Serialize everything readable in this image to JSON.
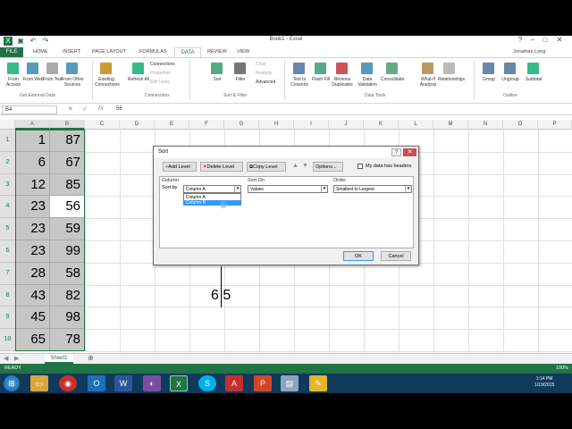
{
  "window": {
    "title": "Book1 - Excel",
    "user": "Jonathan Long"
  },
  "tabs": [
    "FILE",
    "HOME",
    "INSERT",
    "PAGE LAYOUT",
    "FORMULAS",
    "DATA",
    "REVIEW",
    "VIEW"
  ],
  "ribbon": {
    "buttons": [
      {
        "label": "From Access"
      },
      {
        "label": "From Web"
      },
      {
        "label": "From Text"
      },
      {
        "label": "From Other Sources"
      },
      {
        "label": "Existing Connections"
      },
      {
        "label": "Refresh All"
      },
      {
        "label": "Connections"
      },
      {
        "label": "Properties"
      },
      {
        "label": "Edit Links"
      },
      {
        "label": "Sort"
      },
      {
        "label": "Filter"
      },
      {
        "label": "Clear"
      },
      {
        "label": "Reapply"
      },
      {
        "label": "Advanced"
      },
      {
        "label": "Text to Columns"
      },
      {
        "label": "Flash Fill"
      },
      {
        "label": "Remove Duplicates"
      },
      {
        "label": "Data Validation"
      },
      {
        "label": "Consolidate"
      },
      {
        "label": "What-If Analysis"
      },
      {
        "label": "Relationships"
      },
      {
        "label": "Group"
      },
      {
        "label": "Ungroup"
      },
      {
        "label": "Subtotal"
      }
    ],
    "groups": [
      "Get External Data",
      "Connections",
      "Sort & Filter",
      "Data Tools",
      "Outline"
    ]
  },
  "formula_bar": {
    "name_box": "B4",
    "value": "56"
  },
  "columns": [
    "A",
    "B",
    "C",
    "D",
    "E",
    "F",
    "G",
    "H",
    "I",
    "J",
    "K",
    "L",
    "M",
    "N",
    "O",
    "P"
  ],
  "rows": [
    {
      "n": "1",
      "a": "1",
      "b": "87"
    },
    {
      "n": "2",
      "a": "6",
      "b": "67"
    },
    {
      "n": "3",
      "a": "12",
      "b": "85"
    },
    {
      "n": "4",
      "a": "23",
      "b": "56"
    },
    {
      "n": "5",
      "a": "23",
      "b": "59"
    },
    {
      "n": "6",
      "a": "23",
      "b": "99"
    },
    {
      "n": "7",
      "a": "28",
      "b": "58"
    },
    {
      "n": "8",
      "a": "43",
      "b": "82"
    },
    {
      "n": "9",
      "a": "45",
      "b": "98"
    },
    {
      "n": "10",
      "a": "65",
      "b": "78"
    }
  ],
  "dialog": {
    "title": "Sort",
    "help": "?",
    "close": "✕",
    "add_level": "Add Level",
    "delete_level": "Delete Level",
    "copy_level": "Copy Level",
    "options": "Options...",
    "headers_label": "My data has headers",
    "col_header": "Column",
    "sorton_header": "Sort On",
    "order_header": "Order",
    "sort_by": "Sort by",
    "column_value": "Column A",
    "sorton_value": "Values",
    "order_value": "Smallest to Largest",
    "dropdown": [
      "Column A",
      "Column B"
    ],
    "ok": "OK",
    "cancel": "Cancel"
  },
  "overlay_text": "6 5",
  "sheet_tab": "Sheet1",
  "status": {
    "ready": "READY",
    "zoom": "100%"
  },
  "clock": {
    "time": "1:14 PM",
    "date": "1/19/2015"
  }
}
